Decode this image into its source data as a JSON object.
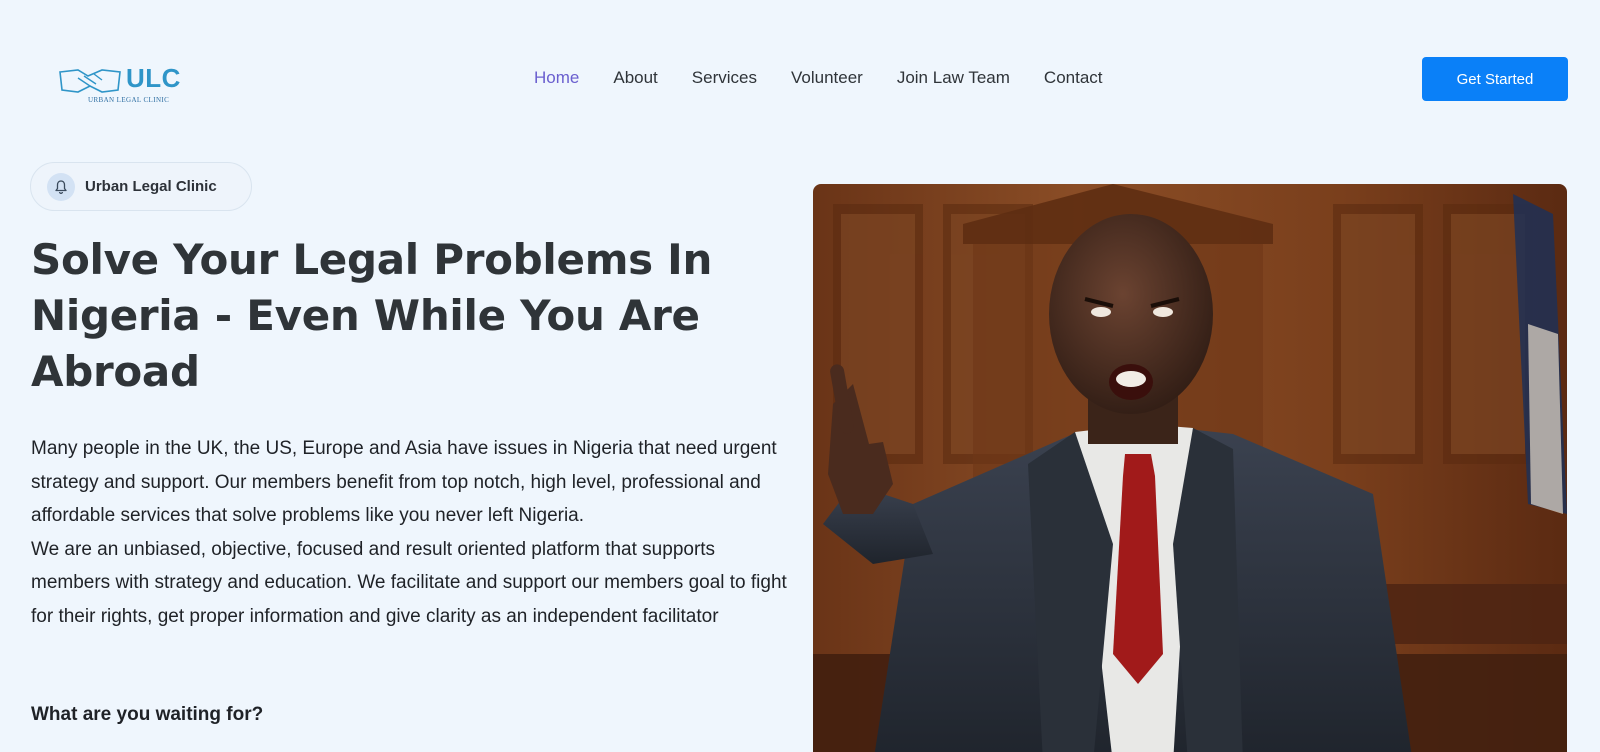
{
  "header": {
    "logo": {
      "abbr": "ULC",
      "subtitle": "URBAN LEGAL CLINIC",
      "icon": "handshake-icon"
    },
    "nav": [
      {
        "label": "Home",
        "active": true
      },
      {
        "label": "About",
        "active": false
      },
      {
        "label": "Services",
        "active": false
      },
      {
        "label": "Volunteer",
        "active": false
      },
      {
        "label": "Join Law Team",
        "active": false
      },
      {
        "label": "Contact",
        "active": false
      }
    ],
    "cta_label": "Get Started"
  },
  "hero": {
    "badge": {
      "label": "Urban Legal Clinic",
      "icon": "bell-icon"
    },
    "title": "Solve Your Legal Problems In Nigeria - Even While You Are Abroad",
    "paragraphs": [
      "Many people in the UK, the US, Europe and Asia have issues in Nigeria that need urgent strategy and support. Our members benefit from top notch, high level, professional and affordable services that solve problems like you never left Nigeria.",
      "We are an unbiased, objective, focused and result oriented platform that supports members with strategy and education. We facilitate and support our members goal to fight for their rights, get proper information and give clarity as an independent facilitator"
    ],
    "closing": "What are you waiting for?",
    "image": {
      "subject": "man-in-suit-shouting-in-courtroom"
    }
  },
  "colors": {
    "background": "#eff6fd",
    "accent": "#0a80f8",
    "nav_active": "#6a5fcf",
    "logo": "#2f95c8",
    "text": "#2f3438"
  }
}
